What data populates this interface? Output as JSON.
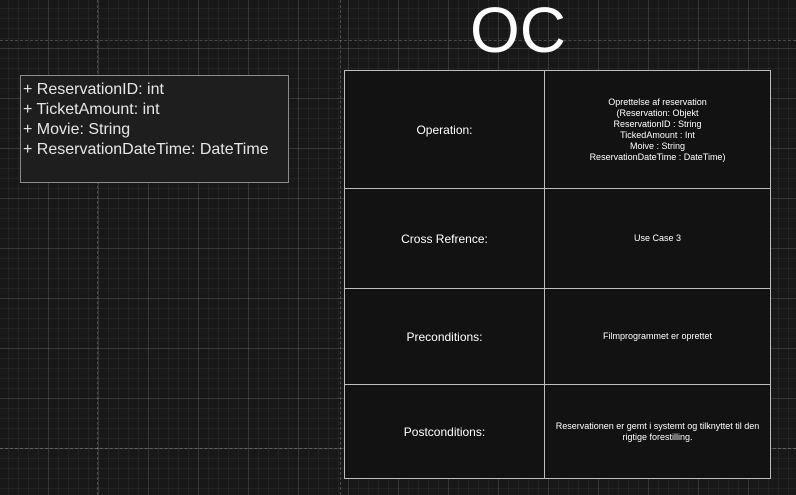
{
  "title": "OC",
  "class_attributes": [
    "+ ReservationID: int",
    "+ TicketAmount: int",
    "+ Movie: String",
    "+ ReservationDateTime: DateTime"
  ],
  "contract": {
    "operation": {
      "label": "Operation:",
      "value_lines": [
        "Oprettelse af reservation",
        "(Reservation: Objekt",
        "ReservationID : String",
        "TickedAmount : Int",
        "Moive : String",
        "ReservationDateTime : DateTime)"
      ]
    },
    "cross_reference": {
      "label": "Cross Refrence:",
      "value": "Use Case 3"
    },
    "preconditions": {
      "label": "Preconditions:",
      "value": "Filmprogrammet er oprettet"
    },
    "postconditions": {
      "label": "Postconditions:",
      "value": "Reservationen er gemt i systemt og tilknyttet til den rigtige forestilling."
    }
  },
  "colors": {
    "background": "#181818",
    "table_fill": "#121212",
    "table_border": "#bdbdbd",
    "class_box_border": "#8c8c8c",
    "text": "#ffffff"
  }
}
